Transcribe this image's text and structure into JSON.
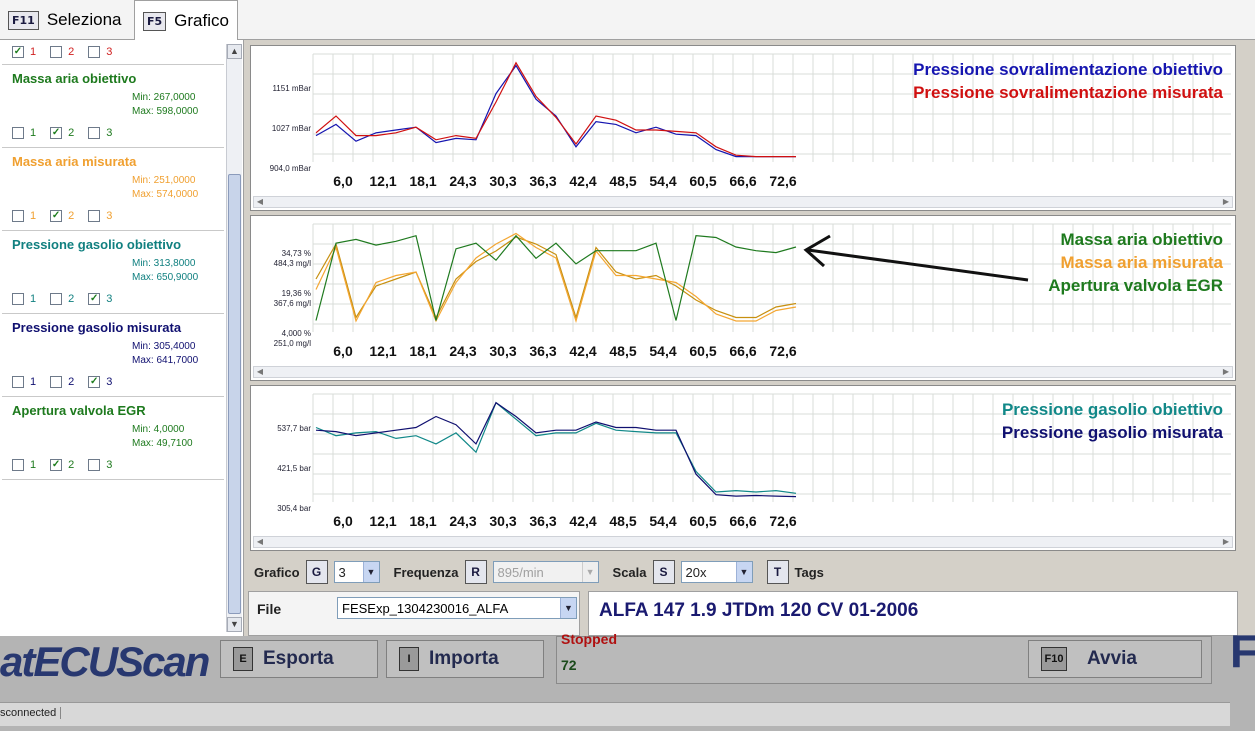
{
  "tabs": [
    {
      "key": "F11",
      "label": "Seleziona"
    },
    {
      "key": "F5",
      "label": "Grafico"
    }
  ],
  "sidebar": {
    "first_checks": [
      "1",
      "2",
      "3"
    ],
    "items": [
      {
        "name": "Massa aria obiettivo",
        "color": "#1e7a1e",
        "min": "Min: 267,0000",
        "max": "Max: 598,0000",
        "checks": [
          "1",
          "2",
          "3"
        ]
      },
      {
        "name": "Massa aria misurata",
        "color": "#f0a030",
        "min": "Min: 251,0000",
        "max": "Max: 574,0000",
        "checks": [
          "1",
          "2",
          "3"
        ]
      },
      {
        "name": "Pressione gasolio obiettivo",
        "color": "#118080",
        "min": "Min: 313,8000",
        "max": "Max: 650,9000",
        "checks": [
          "1",
          "2",
          "3"
        ]
      },
      {
        "name": "Pressione gasolio misurata",
        "color": "#101070",
        "min": "Min: 305,4000",
        "max": "Max: 641,7000",
        "checks": [
          "1",
          "2",
          "3"
        ]
      },
      {
        "name": "Apertura valvola EGR",
        "color": "#1e7a1e",
        "min": "Min: 4,0000",
        "max": "Max: 49,7100",
        "checks": [
          "1",
          "2",
          "3"
        ]
      }
    ]
  },
  "x_ticks": [
    "6,0",
    "12,1",
    "18,1",
    "24,3",
    "30,3",
    "36,3",
    "42,4",
    "48,5",
    "54,4",
    "60,5",
    "66,6",
    "72,6"
  ],
  "chart_data": [
    {
      "type": "line",
      "y_ticks": [
        "1151 mBar",
        "1027 mBar",
        "904,0 mBar"
      ],
      "ylim": [
        904,
        1275
      ],
      "legend": [
        "Pressione sovralimentazione obiettivo",
        "Pressione sovralimentazione misurata"
      ],
      "series": [
        {
          "name": "Pressione sovralimentazione obiettivo",
          "color": "#1515b0",
          "values": [
            990,
            1030,
            970,
            1000,
            1010,
            1020,
            965,
            980,
            975,
            1140,
            1240,
            1120,
            1060,
            950,
            1040,
            1030,
            1000,
            1020,
            995,
            990,
            940,
            915,
            915,
            915,
            915
          ]
        },
        {
          "name": "Pressione sovralimentazione misurata",
          "color": "#d01010",
          "values": [
            1000,
            1060,
            990,
            990,
            1000,
            1020,
            975,
            990,
            980,
            1110,
            1250,
            1130,
            1055,
            960,
            1060,
            1045,
            1010,
            1010,
            1005,
            1000,
            950,
            920,
            915,
            915,
            915
          ]
        }
      ]
    },
    {
      "type": "line",
      "y_ticks_left": [
        "34,73 %",
        "19,36 %",
        "4,000 %"
      ],
      "y_ticks_right": [
        "484,3 mg/l",
        "367,6 mg/l",
        "251,0 mg/l"
      ],
      "legend": [
        "Massa aria obiettivo",
        "Massa aria misurata",
        "Apertura valvola EGR"
      ],
      "series": [
        {
          "name": "Massa aria obiettivo",
          "color": "#c79010",
          "values": [
            380,
            480,
            270,
            360,
            380,
            400,
            270,
            380,
            430,
            460,
            500,
            480,
            450,
            270,
            470,
            400,
            380,
            390,
            360,
            320,
            290,
            270,
            270,
            300,
            310
          ]
        },
        {
          "name": "Massa aria misurata",
          "color": "#f4a733",
          "values": [
            350,
            470,
            260,
            370,
            390,
            400,
            260,
            370,
            440,
            480,
            510,
            470,
            440,
            260,
            460,
            390,
            390,
            380,
            370,
            330,
            280,
            260,
            260,
            290,
            300
          ]
        },
        {
          "name": "Apertura valvola EGR",
          "color": "#1f7a1f",
          "values": [
            4,
            45,
            47,
            44,
            46,
            49,
            4,
            42,
            45,
            36,
            49,
            37,
            45,
            34,
            41,
            41,
            41,
            45,
            4,
            49,
            48,
            43,
            41,
            40,
            43
          ]
        }
      ]
    },
    {
      "type": "line",
      "y_ticks": [
        "537,7 bar",
        "421,5 bar",
        "305,4 bar"
      ],
      "legend": [
        "Pressione gasolio obiettivo",
        "Pressione gasolio misurata"
      ],
      "series": [
        {
          "name": "Pressione gasolio obiettivo",
          "color": "#118888",
          "values": [
            560,
            530,
            540,
            545,
            520,
            530,
            500,
            540,
            470,
            650,
            590,
            530,
            540,
            540,
            575,
            550,
            545,
            540,
            540,
            400,
            325,
            330,
            325,
            330,
            320
          ]
        },
        {
          "name": "Pressione gasolio misurata",
          "color": "#101070",
          "values": [
            550,
            545,
            530,
            540,
            550,
            560,
            600,
            570,
            500,
            650,
            600,
            540,
            550,
            550,
            580,
            560,
            560,
            550,
            550,
            390,
            315,
            310,
            312,
            310,
            308
          ]
        }
      ]
    }
  ],
  "controls": {
    "grafico_label": "Grafico",
    "grafico_key": "G",
    "grafico_value": "3",
    "frequenza_label": "Frequenza",
    "frequenza_key": "R",
    "frequenza_value": "895/min",
    "scala_label": "Scala",
    "scala_key": "S",
    "scala_value": "20x",
    "tags_key": "T",
    "tags_label": "Tags"
  },
  "file": {
    "label": "File",
    "value": "FESExp_1304230016_ALFA"
  },
  "vehicle": {
    "title": "ALFA 147 1.9 JTDm 120 CV 01-2006"
  },
  "bottom": {
    "logo": "atECUScan",
    "status_stopped": "Stopped",
    "counter": "72",
    "export": {
      "key": "E",
      "label": "Esporta"
    },
    "import": {
      "key": "I",
      "label": "Importa"
    },
    "start": {
      "key": "F10",
      "label": "Avvia"
    },
    "right_char": "F",
    "status_text": "sconnected"
  }
}
